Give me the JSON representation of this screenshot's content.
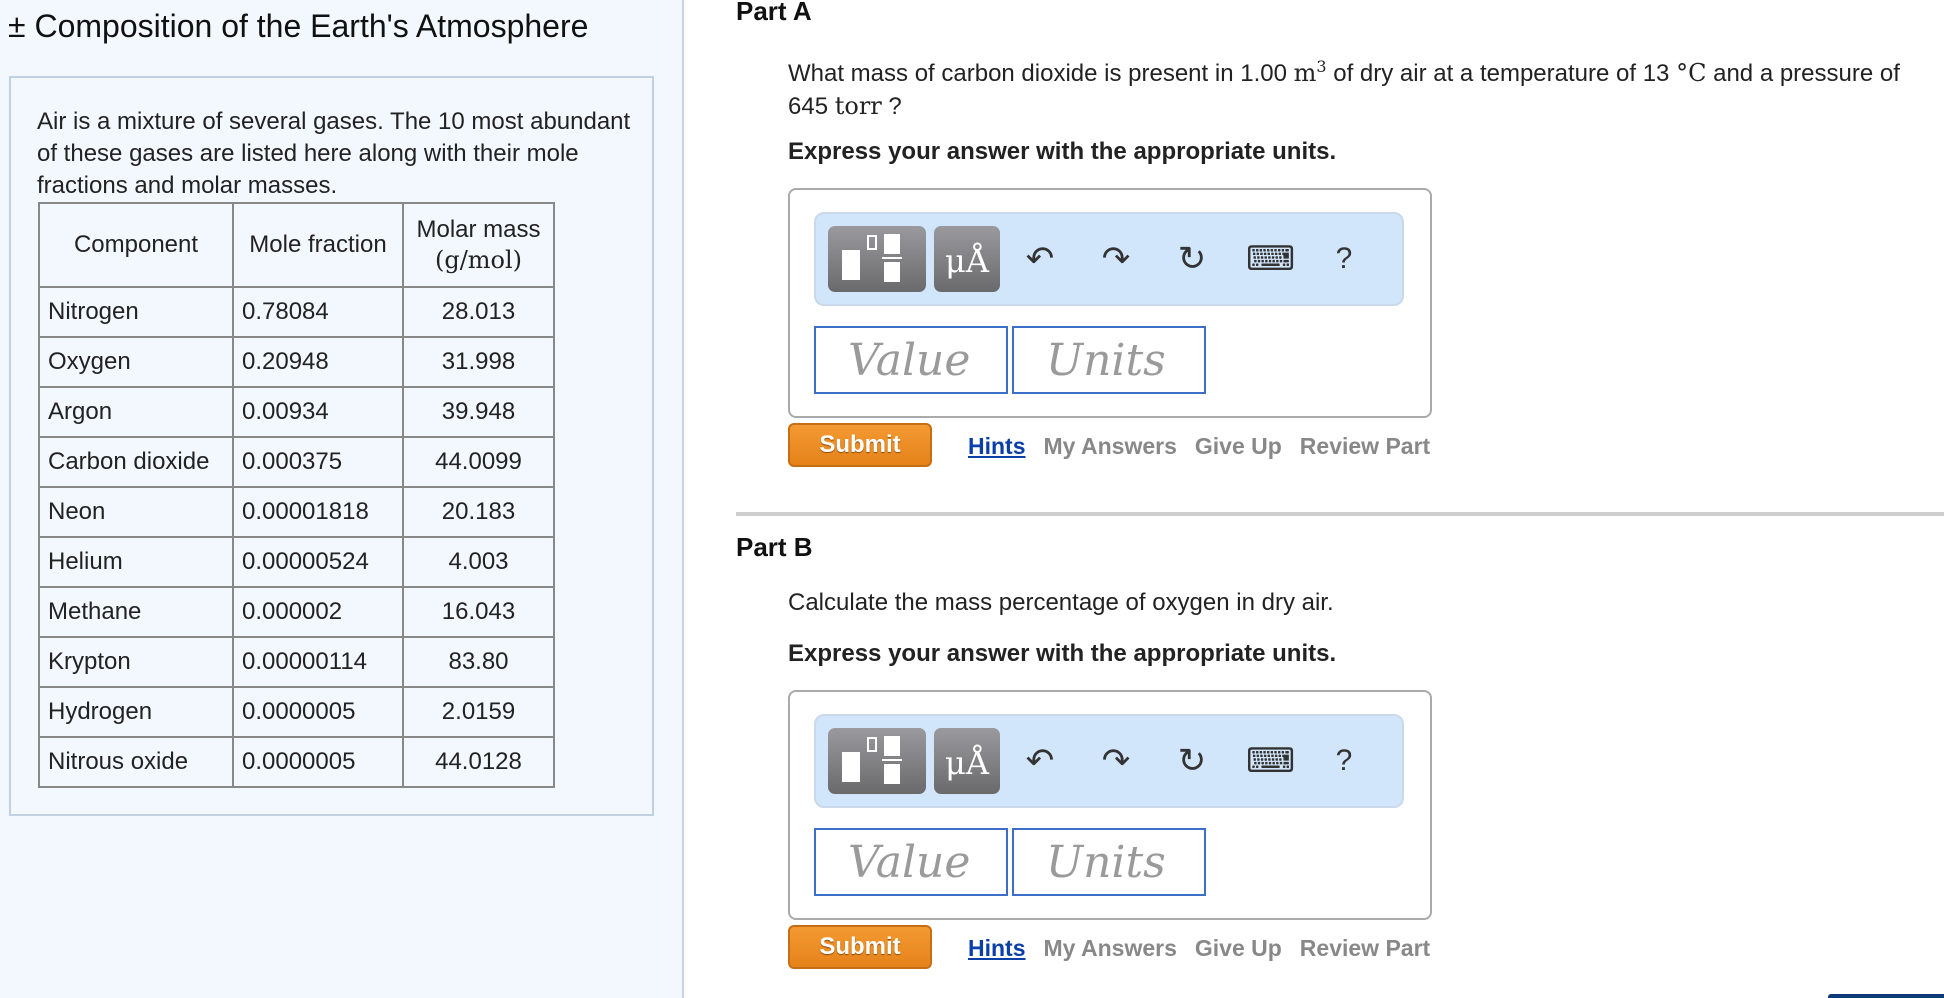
{
  "left_panel": {
    "title": "± Composition of the Earth's Atmosphere",
    "intro": "Air is a mixture of several gases. The 10 most abundant of these gases are listed here along with their mole fractions and molar masses.",
    "table": {
      "headers": [
        "Component",
        "Mole fraction",
        "Molar mass",
        "(g/mol)"
      ],
      "rows": [
        [
          "Nitrogen",
          "0.78084",
          "28.013"
        ],
        [
          "Oxygen",
          "0.20948",
          "31.998"
        ],
        [
          "Argon",
          "0.00934",
          "39.948"
        ],
        [
          "Carbon dioxide",
          "0.000375",
          "44.0099"
        ],
        [
          "Neon",
          "0.00001818",
          "20.183"
        ],
        [
          "Helium",
          "0.00000524",
          "4.003"
        ],
        [
          "Methane",
          "0.000002",
          "16.043"
        ],
        [
          "Krypton",
          "0.00000114",
          "83.80"
        ],
        [
          "Hydrogen",
          "0.0000005",
          "2.0159"
        ],
        [
          "Nitrous oxide",
          "0.0000005",
          "44.0128"
        ]
      ]
    }
  },
  "parts": [
    {
      "title": "Part A",
      "question": {
        "t1": "What mass of carbon dioxide is present in 1.00 ",
        "unit1": "m",
        "sup": "3",
        "t2": " of dry air at a temperature of 13 ",
        "unit2": "°C",
        "t3": " and a pressure of 645 ",
        "unit3": "torr",
        "t4": " ?"
      },
      "instruction": "Express your answer with the appropriate units.",
      "toolbar": {
        "units_button": "μÅ",
        "undo": "↶",
        "redo": "↷",
        "reset": "↻",
        "keyboard": "⌨",
        "help": "?"
      },
      "value_placeholder": "Value",
      "units_placeholder": "Units",
      "submit": "Submit",
      "links": [
        "Hints",
        "My Answers",
        "Give Up",
        "Review Part"
      ]
    },
    {
      "title": "Part B",
      "question": {
        "t1": "Calculate the mass percentage of oxygen in dry air."
      },
      "instruction": "Express your answer with the appropriate units.",
      "toolbar": {
        "units_button": "μÅ",
        "undo": "↶",
        "redo": "↷",
        "reset": "↻",
        "keyboard": "⌨",
        "help": "?"
      },
      "value_placeholder": "Value",
      "units_placeholder": "Units",
      "submit": "Submit",
      "links": [
        "Hints",
        "My Answers",
        "Give Up",
        "Review Part"
      ]
    }
  ]
}
